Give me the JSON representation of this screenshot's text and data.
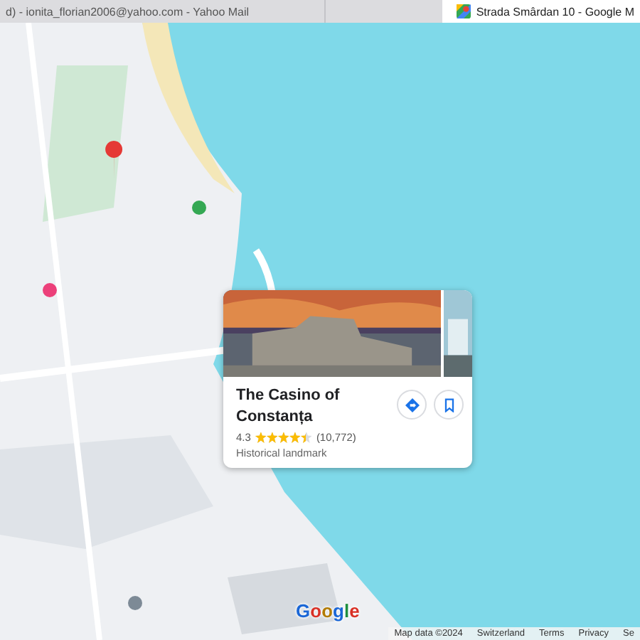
{
  "browser_tabs": [
    {
      "title": "d) - ionita_florian2006@yahoo.com - Yahoo Mail",
      "selected": false
    },
    {
      "title": "Strada Smârdan 10 - Google M",
      "selected": true
    }
  ],
  "place_card": {
    "title": "The Casino of Constanța",
    "rating": "4.3",
    "stars": 4.5,
    "review_count": "(10,772)",
    "category": "Historical landmark"
  },
  "logo": "Google",
  "footer": [
    "Map data ©2024",
    "Switzerland",
    "Terms",
    "Privacy",
    "Se"
  ]
}
